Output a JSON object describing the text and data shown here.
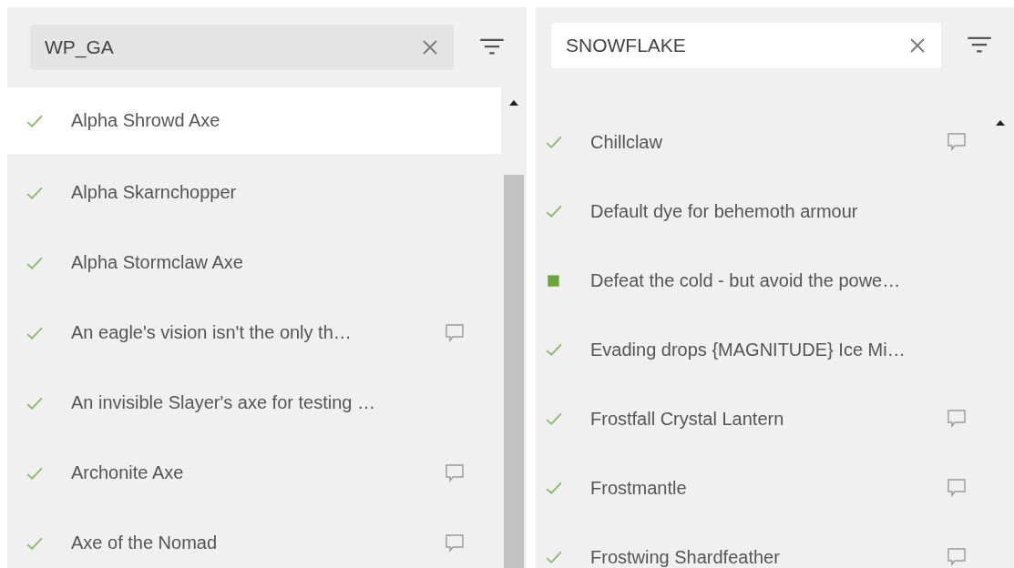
{
  "panels": [
    {
      "search": {
        "value": "WP_GA",
        "hovered": true
      },
      "scrollbar_thumb": true,
      "items": [
        {
          "label": "Alpha Shrowd Axe",
          "kind": "check",
          "comment": false,
          "selected": true
        },
        {
          "label": "Alpha Skarnchopper",
          "kind": "check",
          "comment": false,
          "selected": false
        },
        {
          "label": "Alpha Stormclaw Axe",
          "kind": "check",
          "comment": false,
          "selected": false
        },
        {
          "label": "An eagle's vision isn't the only th…",
          "kind": "check",
          "comment": true,
          "selected": false
        },
        {
          "label": "An invisible Slayer's axe for testing …",
          "kind": "check",
          "comment": false,
          "selected": false
        },
        {
          "label": "Archonite Axe",
          "kind": "check",
          "comment": true,
          "selected": false
        },
        {
          "label": "Axe of the Nomad",
          "kind": "check",
          "comment": true,
          "selected": false
        }
      ]
    },
    {
      "search": {
        "value": "SNOWFLAKE",
        "hovered": false
      },
      "scrollbar_thumb": false,
      "items": [
        {
          "label": "Chillclaw",
          "kind": "check",
          "comment": true,
          "selected": false
        },
        {
          "label": "Default dye for behemoth armour",
          "kind": "check",
          "comment": false,
          "selected": false
        },
        {
          "label": "Defeat the cold - but avoid the powe…",
          "kind": "square",
          "comment": false,
          "selected": false
        },
        {
          "label": "Evading drops {MAGNITUDE} Ice Mi…",
          "kind": "check",
          "comment": false,
          "selected": false
        },
        {
          "label": "Frostfall Crystal Lantern",
          "kind": "check",
          "comment": true,
          "selected": false
        },
        {
          "label": "Frostmantle",
          "kind": "check",
          "comment": true,
          "selected": false
        },
        {
          "label": "Frostwing Shardfeather",
          "kind": "check",
          "comment": true,
          "selected": false
        }
      ]
    }
  ]
}
